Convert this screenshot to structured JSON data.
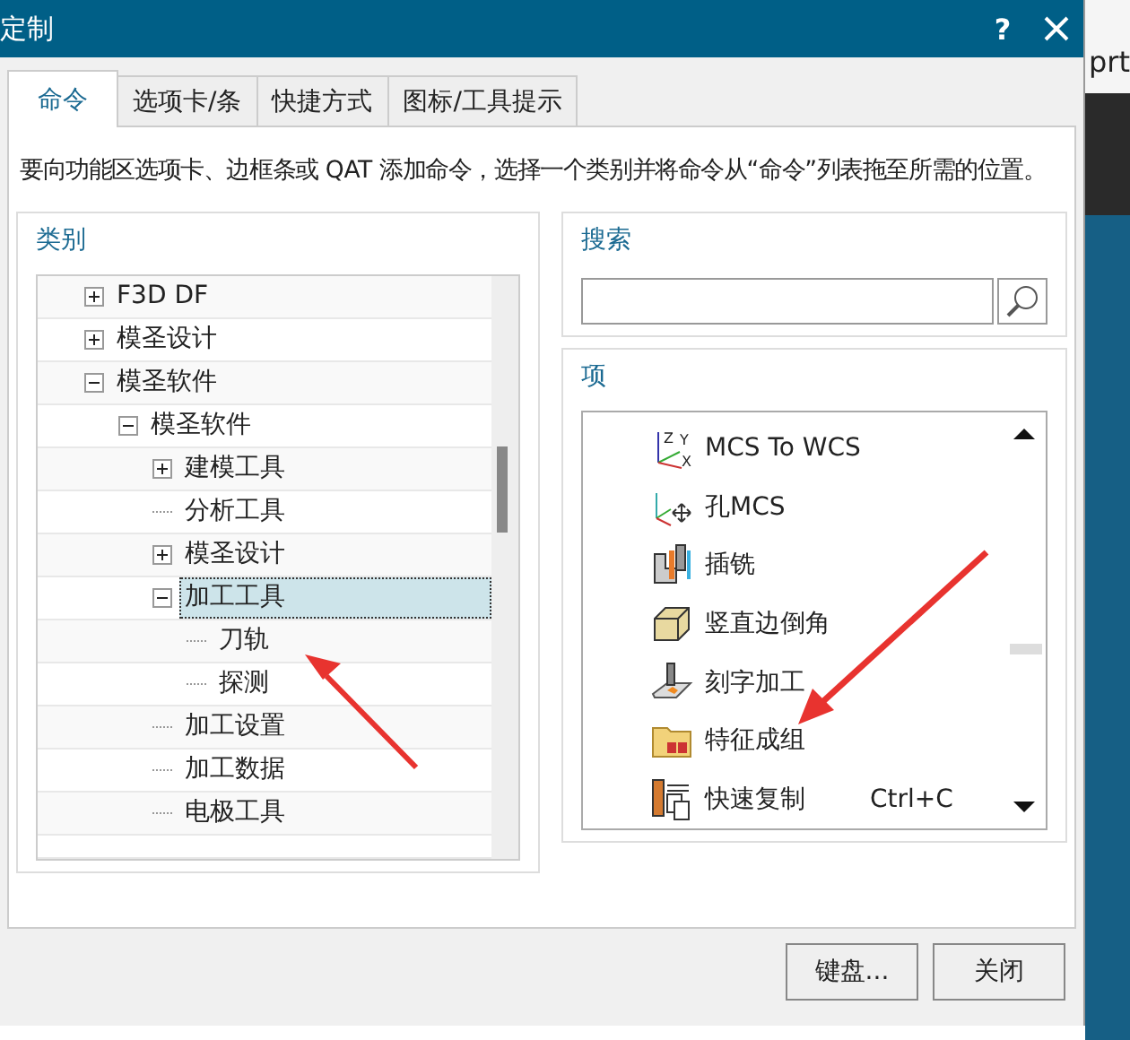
{
  "window": {
    "title": "定制",
    "help": "?"
  },
  "tabs": [
    {
      "label": "命令",
      "selected": true
    },
    {
      "label": "选项卡/条",
      "selected": false
    },
    {
      "label": "快捷方式",
      "selected": false
    },
    {
      "label": "图标/工具提示",
      "selected": false
    }
  ],
  "description": "要向功能区选项卡、边框条或 QAT 添加命令，选择一个类别并将命令从“命令”列表拖至所需的位置。",
  "category": {
    "title": "类别",
    "tree": [
      {
        "label": "F3D DF",
        "expanded": false,
        "selected": false
      },
      {
        "label": "模圣设计",
        "expanded": false,
        "selected": false
      },
      {
        "label": "模圣软件",
        "expanded": true,
        "selected": false,
        "children": [
          {
            "label": "模圣软件",
            "expanded": true,
            "selected": false,
            "children": [
              {
                "label": "建模工具",
                "expanded": false,
                "selected": false
              },
              {
                "label": "分析工具",
                "selected": false
              },
              {
                "label": "模圣设计",
                "expanded": false,
                "selected": false
              },
              {
                "label": "加工工具",
                "expanded": true,
                "selected": true,
                "children": [
                  {
                    "label": "刀轨",
                    "selected": false
                  },
                  {
                    "label": "探测",
                    "selected": false
                  }
                ]
              },
              {
                "label": "加工设置",
                "selected": false
              },
              {
                "label": "加工数据",
                "selected": false
              },
              {
                "label": "电极工具",
                "selected": false
              }
            ]
          }
        ]
      }
    ]
  },
  "search": {
    "title": "搜索"
  },
  "items": {
    "title": "项",
    "list": [
      {
        "label": "MCS To WCS",
        "icon_labels": [
          "Z",
          "Y",
          "X"
        ]
      },
      {
        "label": "孔MCS"
      },
      {
        "label": "插铣"
      },
      {
        "label": "竖直边倒角"
      },
      {
        "label": "刻字加工"
      },
      {
        "label": "特征成组"
      },
      {
        "label": "快速复制",
        "shortcut": "Ctrl+C"
      }
    ]
  },
  "buttons": [
    "键盘...",
    "关闭"
  ],
  "background": {
    "text": "prt"
  }
}
